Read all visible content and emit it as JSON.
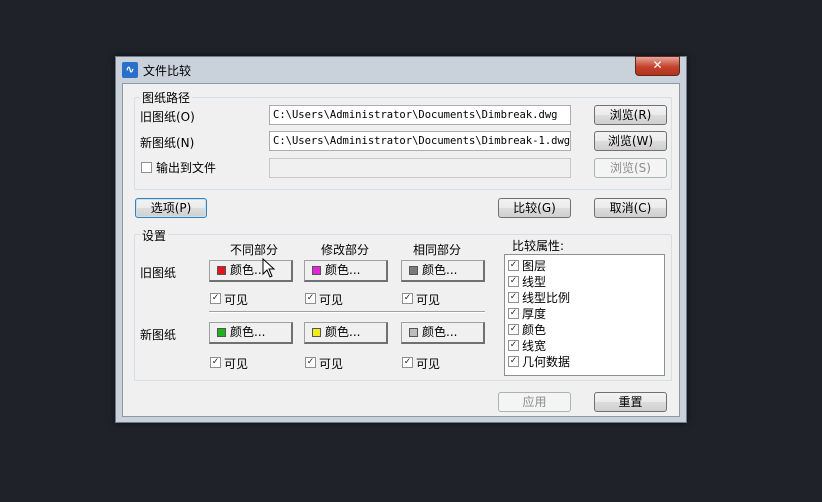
{
  "window": {
    "title": "文件比较",
    "app_icon_glyph": "∿",
    "close_glyph": "✕"
  },
  "paths": {
    "group_title": "图纸路径",
    "old_label": "旧图纸(O)",
    "old_value": "C:\\Users\\Administrator\\Documents\\Dimbreak.dwg",
    "old_browse": "浏览(R)",
    "new_label": "新图纸(N)",
    "new_value": "C:\\Users\\Administrator\\Documents\\Dimbreak-1.dwg",
    "new_browse": "浏览(W)",
    "output_label": "输出到文件",
    "output_value": "",
    "output_browse": "浏览(S)"
  },
  "actions": {
    "options": "选项(P)",
    "compare": "比较(G)",
    "cancel": "取消(C)"
  },
  "settings": {
    "group_title": "设置",
    "col_different": "不同部分",
    "col_modified": "修改部分",
    "col_same": "相同部分",
    "row_old": "旧图纸",
    "row_new": "新图纸",
    "color_label": "颜色...",
    "visible_label": "可见",
    "check_glyph": "✓",
    "colors": {
      "old_different": "#e8141b",
      "old_modified": "#e424d9",
      "old_same": "#7a7a7a",
      "new_different": "#1eb41e",
      "new_modified": "#f2ec1a",
      "new_same": "#bdbdbd"
    }
  },
  "compare_props": {
    "title": "比较属性:",
    "items": [
      "图层",
      "线型",
      "线型比例",
      "厚度",
      "颜色",
      "线宽",
      "几何数据"
    ]
  },
  "footer": {
    "apply": "应用",
    "reset": "重置"
  }
}
